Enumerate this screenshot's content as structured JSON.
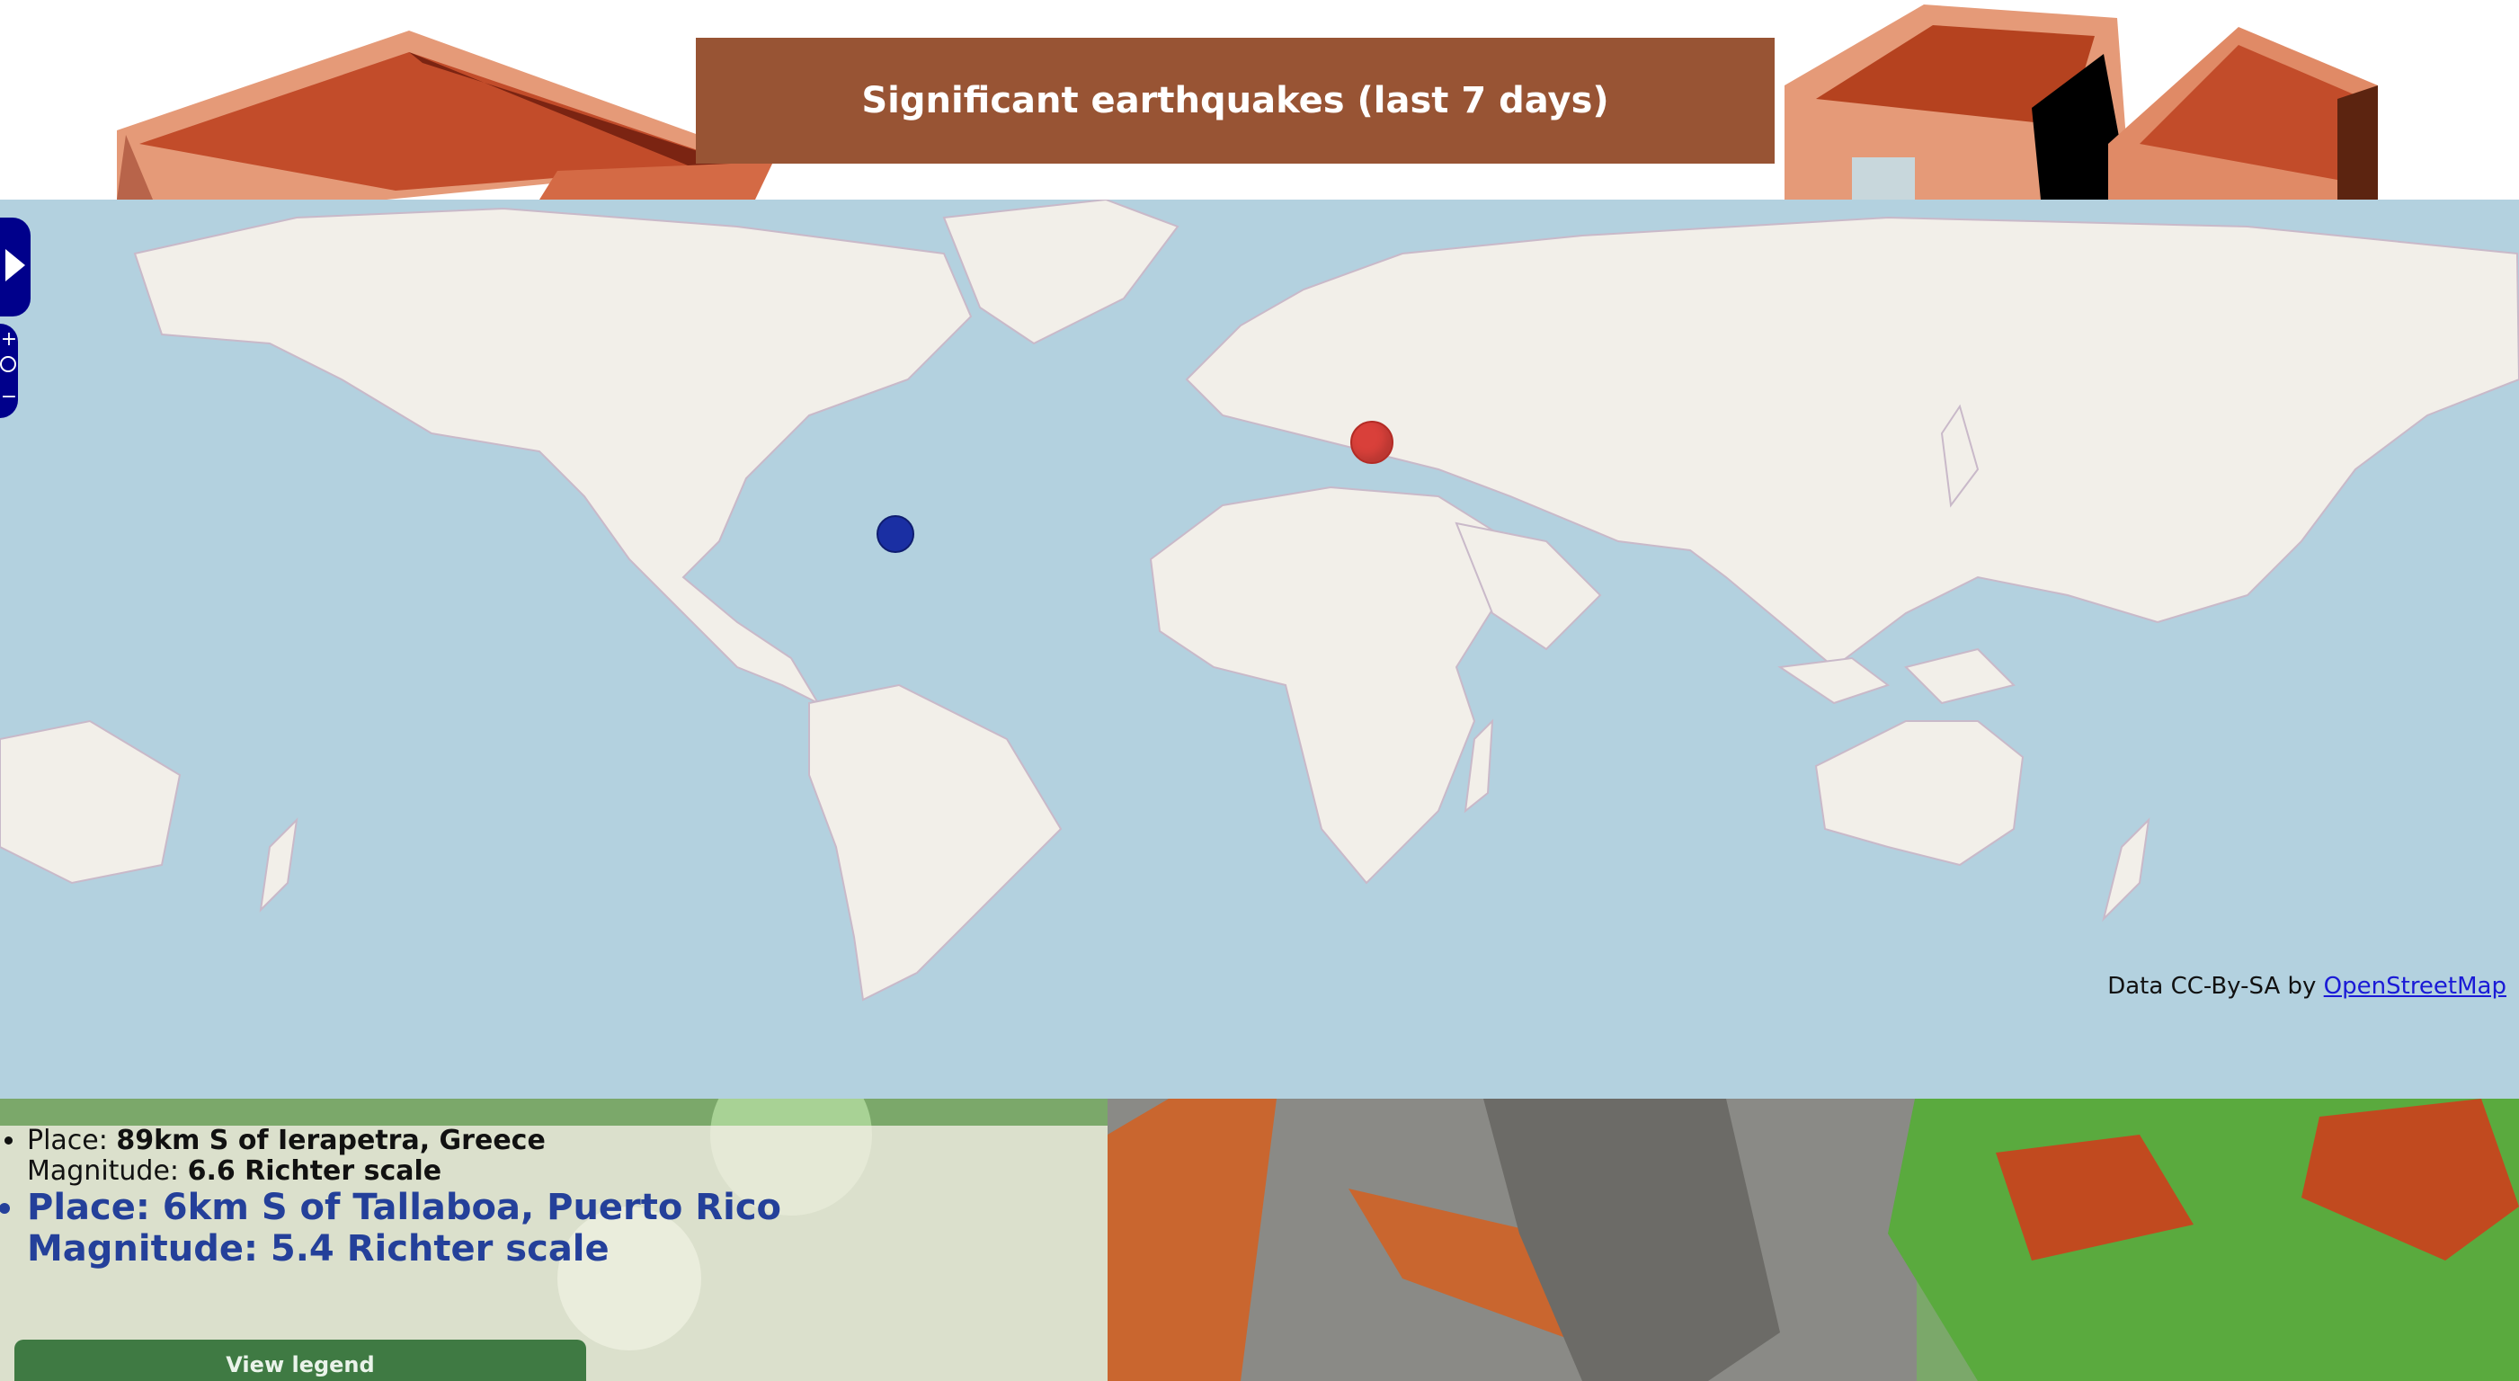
{
  "header": {
    "title": "Significant earthquakes (last 7 days)"
  },
  "map": {
    "attribution_prefix": "Data CC-By-SA by ",
    "attribution_link": "OpenStreetMap",
    "markers": [
      {
        "place": "89km S of Ierapetra, Greece",
        "color": "#d9403a",
        "selected": false
      },
      {
        "place": "6km S of Tallaboa, Puerto Rico",
        "color": "#1a2fa3",
        "selected": true
      }
    ]
  },
  "earthquakes": [
    {
      "place_label": "Place: ",
      "place": "89km S of Ierapetra, Greece",
      "magnitude_label": "Magnitude: ",
      "magnitude": "6.6 Richter scale"
    },
    {
      "place_label": "Place: ",
      "place": "6km S of Tallaboa, Puerto Rico",
      "magnitude_label": "Magnitude: ",
      "magnitude": "5.4 Richter scale"
    }
  ],
  "legend_button": "View legend",
  "colors": {
    "header_bg": "#985434",
    "sea": "#b3d1df",
    "land": "#f2efe9",
    "legend_button": "#3f7a43"
  }
}
